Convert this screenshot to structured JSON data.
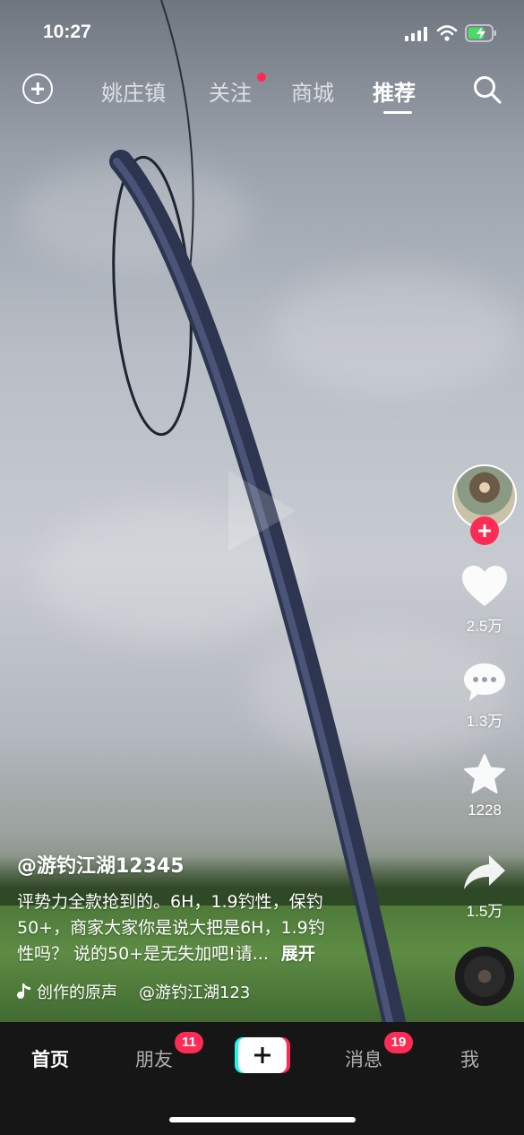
{
  "status_bar": {
    "time": "10:27"
  },
  "top_nav": {
    "tabs": [
      {
        "label": "姚庄镇"
      },
      {
        "label": "关注"
      },
      {
        "label": "商城"
      },
      {
        "label": "推荐"
      }
    ],
    "active_tab": "推荐"
  },
  "sidebar": {
    "like_count": "2.5万",
    "comment_count": "1.3万",
    "favorite_count": "1228",
    "share_count": "1.5万"
  },
  "post": {
    "author": "@游钓江湖12345",
    "description_lines": [
      "评势力全款抢到的。6H，1.9钓性，保钓",
      "50+，商家大家你是说大把是6H，1.9钓",
      "性吗？ 说的50+是无失加吧!请..."
    ],
    "expand_label": "展开",
    "music_title": "创作的原声",
    "music_author": "@游钓江湖123"
  },
  "bottom_nav": {
    "home": "首页",
    "friends": "朋友",
    "friends_badge": "11",
    "messages": "消息",
    "messages_badge": "19",
    "me": "我"
  },
  "colors": {
    "accent": "#fe2c55",
    "tabbar": "#161616",
    "cyan": "#25f4ee"
  },
  "icons": [
    "add-circle-icon",
    "search-icon",
    "heart-icon",
    "comment-icon",
    "star-icon",
    "share-icon",
    "music-note-icon",
    "plus-icon"
  ]
}
